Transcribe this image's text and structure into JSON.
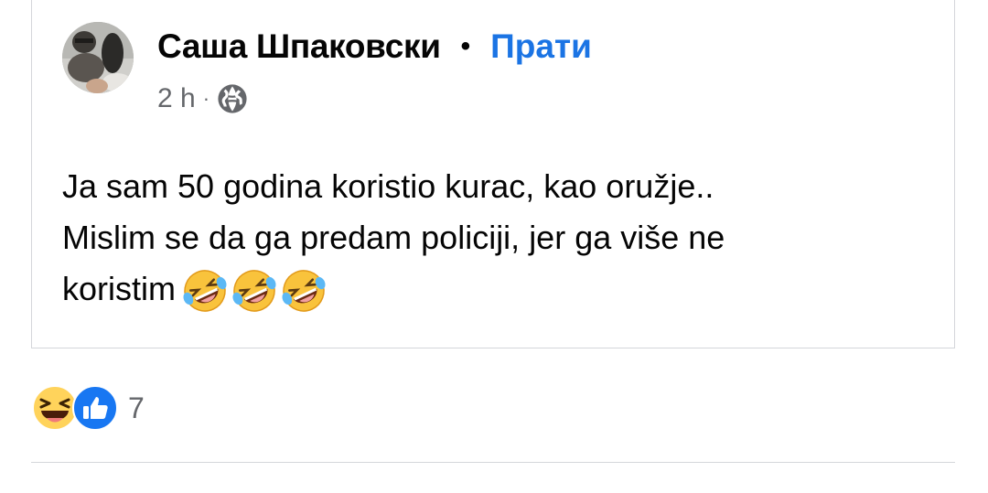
{
  "post": {
    "author": "Саша Шпаковски",
    "separator": "•",
    "follow_label": "Прати",
    "time": "2 h",
    "meta_dot": "·",
    "privacy_icon": "globe-icon",
    "text_lines": [
      "Ja sam 50 godina koristio kurac, kao oružje..",
      "Mislim se da ga predam policiji, jer ga više ne",
      "koristim"
    ],
    "emojis": [
      "rolling-on-floor-laughing",
      "rolling-on-floor-laughing",
      "rolling-on-floor-laughing"
    ]
  },
  "reactions": {
    "icons": [
      "haha-reaction-icon",
      "like-reaction-icon"
    ],
    "count": "7"
  },
  "colors": {
    "follow": "#1b74e4",
    "meta": "#65676b",
    "border": "#d4d6da"
  }
}
